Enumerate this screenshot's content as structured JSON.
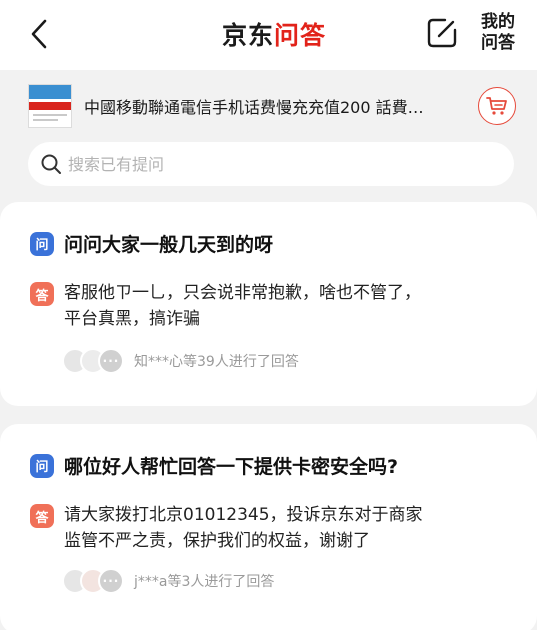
{
  "header": {
    "logo_jd": "京东",
    "logo_qa": "问答",
    "back_icon": "chevron-left-icon",
    "share_icon": "share-icon",
    "mine_line1": "我的",
    "mine_line2": "问答"
  },
  "product": {
    "title": "中國移動聯通電信手机话费慢充充值200 話費…",
    "cart_icon": "cart-icon"
  },
  "search": {
    "placeholder": "搜索已有提问"
  },
  "questions": [
    {
      "q_badge": "问",
      "question": "问问大家一般几天到的呀",
      "a_badge": "答",
      "answer_line1": "客服他ㄗ一乚，只会说非常抱歉，啥也不管了，",
      "answer_line2": "平台真黑，搞诈骗",
      "answer_count_text": "知***心等39人进行了回答"
    },
    {
      "q_badge": "问",
      "question": "哪位好人帮忙回答一下提供卡密安全吗?",
      "a_badge": "答",
      "answer_line1": "请大家拨打北京01012345，投诉京东对于商家",
      "answer_line2": "监管不严之责，保护我们的权益，谢谢了",
      "answer_count_text": "j***a等3人进行了回答"
    }
  ],
  "colors": {
    "question_badge": "#3a72d9",
    "answer_badge": "#f07058",
    "brand_red": "#e2231a"
  }
}
